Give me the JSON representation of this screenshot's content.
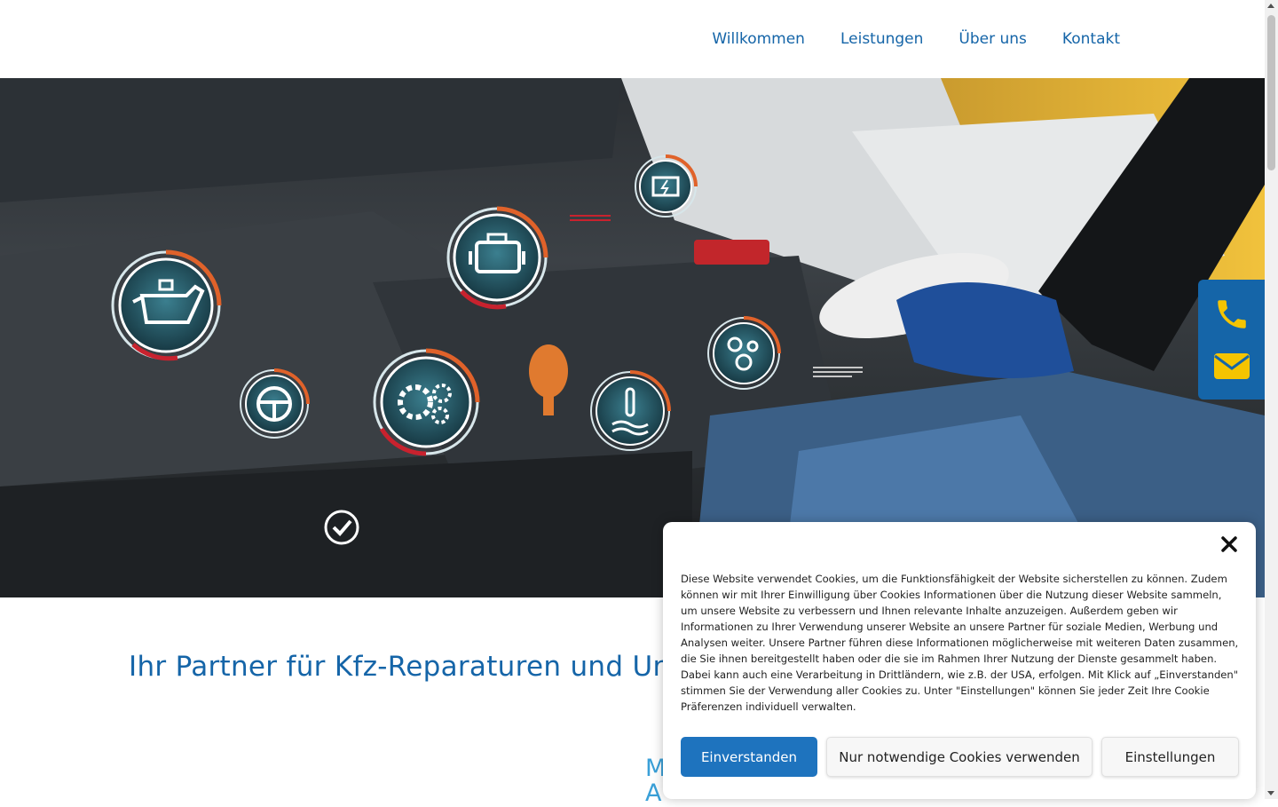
{
  "nav": {
    "items": [
      {
        "label": "Willkommen"
      },
      {
        "label": "Leistungen"
      },
      {
        "label": "Über uns"
      },
      {
        "label": "Kontakt"
      }
    ]
  },
  "hero": {
    "description_icons": [
      "oil-can-icon",
      "engine-icon",
      "battery-icon",
      "steering-wheel-icon",
      "gears-icon",
      "coolant-temperature-icon",
      "belt-pulley-icon",
      "check-circle-icon"
    ]
  },
  "contact_float": {
    "icons": [
      "phone-icon",
      "envelope-icon"
    ],
    "accent_color": "#f5c400"
  },
  "main": {
    "headline": "Ihr Partner für Kfz-Reparaturen und Unt",
    "sub_lines": [
      "M",
      "A"
    ]
  },
  "cookie_banner": {
    "text": "Diese Website verwendet Cookies, um die Funktionsfähigkeit der Website sicherstellen zu können. Zudem können wir mit Ihrer Einwilligung über Cookies Informationen über die Nutzung dieser Website sammeln, um unsere Website zu verbessern und Ihnen relevante Inhalte anzuzeigen. Außerdem geben wir Informationen zu Ihrer Verwendung unserer Website an unsere Partner für soziale Medien, Werbung und Analysen weiter. Unsere Partner führen diese Informationen möglicherweise mit weiteren Daten zusammen, die Sie ihnen bereitgestellt haben oder die sie im Rahmen Ihrer Nutzung der Dienste gesammelt haben. Dabei kann auch eine Verarbeitung in Drittländern, wie z.B. der USA, erfolgen. Mit Klick auf „Einverstanden\" stimmen Sie der Verwendung aller Cookies zu. Unter \"Einstellungen\" können Sie jeder Zeit Ihre Cookie Präferenzen individuell verwalten.",
    "accept_label": "Einverstanden",
    "necessary_label": "Nur notwendige Cookies verwenden",
    "settings_label": "Einstellungen"
  },
  "colors": {
    "brand_blue": "#1565a8",
    "accept_button": "#1e73be",
    "light_blue_text": "#3aa0d8"
  }
}
